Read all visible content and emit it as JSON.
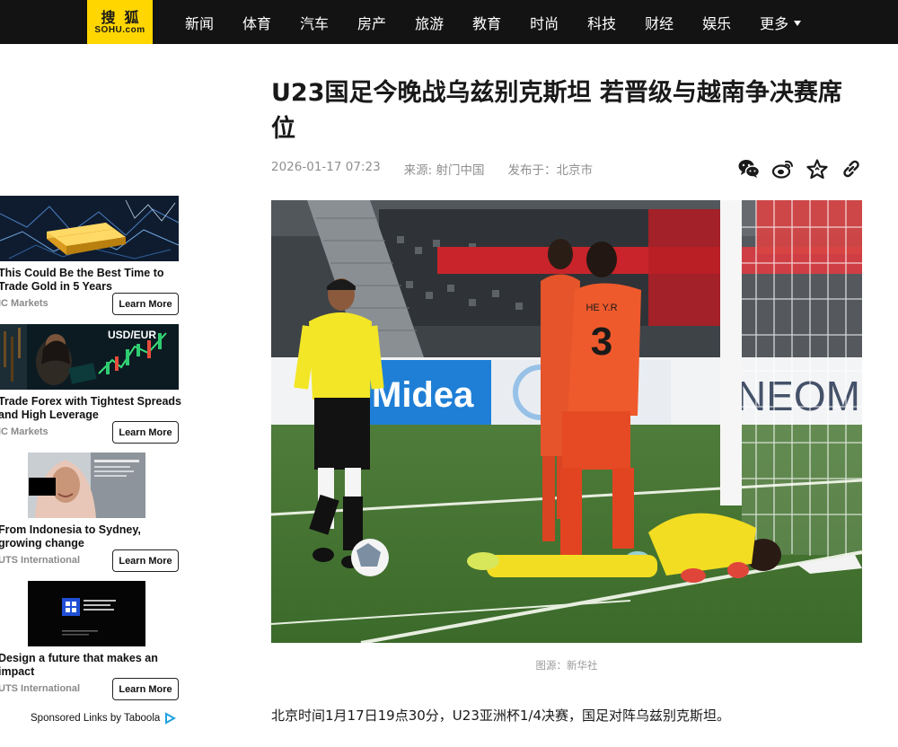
{
  "brand": {
    "logo_cn": "搜狐",
    "logo_en": "SOHU.com",
    "accent": "#ffd600",
    "bar_color": "#131313"
  },
  "nav": {
    "items": [
      "新闻",
      "体育",
      "汽车",
      "房产",
      "旅游",
      "教育",
      "时尚",
      "科技",
      "财经",
      "娱乐"
    ],
    "more": "更多"
  },
  "ads": [
    {
      "title": "This Could Be the Best Time to Trade Gold in 5 Years",
      "source": "IC Markets",
      "button": "Learn More",
      "image": "gold-bars-illustration"
    },
    {
      "title": "Trade Forex with Tightest Spreads and High Leverage",
      "source": "IC Markets",
      "button": "Learn More",
      "image": "forex-trader-usd-eur",
      "image_text": "USD/EUR"
    },
    {
      "title": "From Indonesia to Sydney, growing change",
      "source": "UTS International",
      "button": "Learn More",
      "image": "student-portrait"
    },
    {
      "title": "Design a future that makes an impact",
      "source": "UTS International",
      "button": "Learn More",
      "image": "uts-logo-dark"
    }
  ],
  "sponsored": {
    "label": "Sponsored Links by Taboola",
    "icon": "taboola-icon"
  },
  "article": {
    "title": "U23国足今晚战乌兹别克斯坦 若晋级与越南争决赛席位",
    "date": "2026-01-17 07:23",
    "source": "来源: 射门中国",
    "location": "发布于：北京市",
    "share_icons": [
      "wechat-icon",
      "weibo-icon",
      "star-icon",
      "link-icon"
    ],
    "photo_caption": "图源：新华社",
    "photo_text": {
      "player_name": "HE Y.R",
      "player_number": "3",
      "board_1": "Midea",
      "board_2": "NEOM"
    },
    "lead": "北京时间1月17日19点30分，U23亚洲杯1/4决赛，国足对阵乌兹别克斯坦。"
  }
}
